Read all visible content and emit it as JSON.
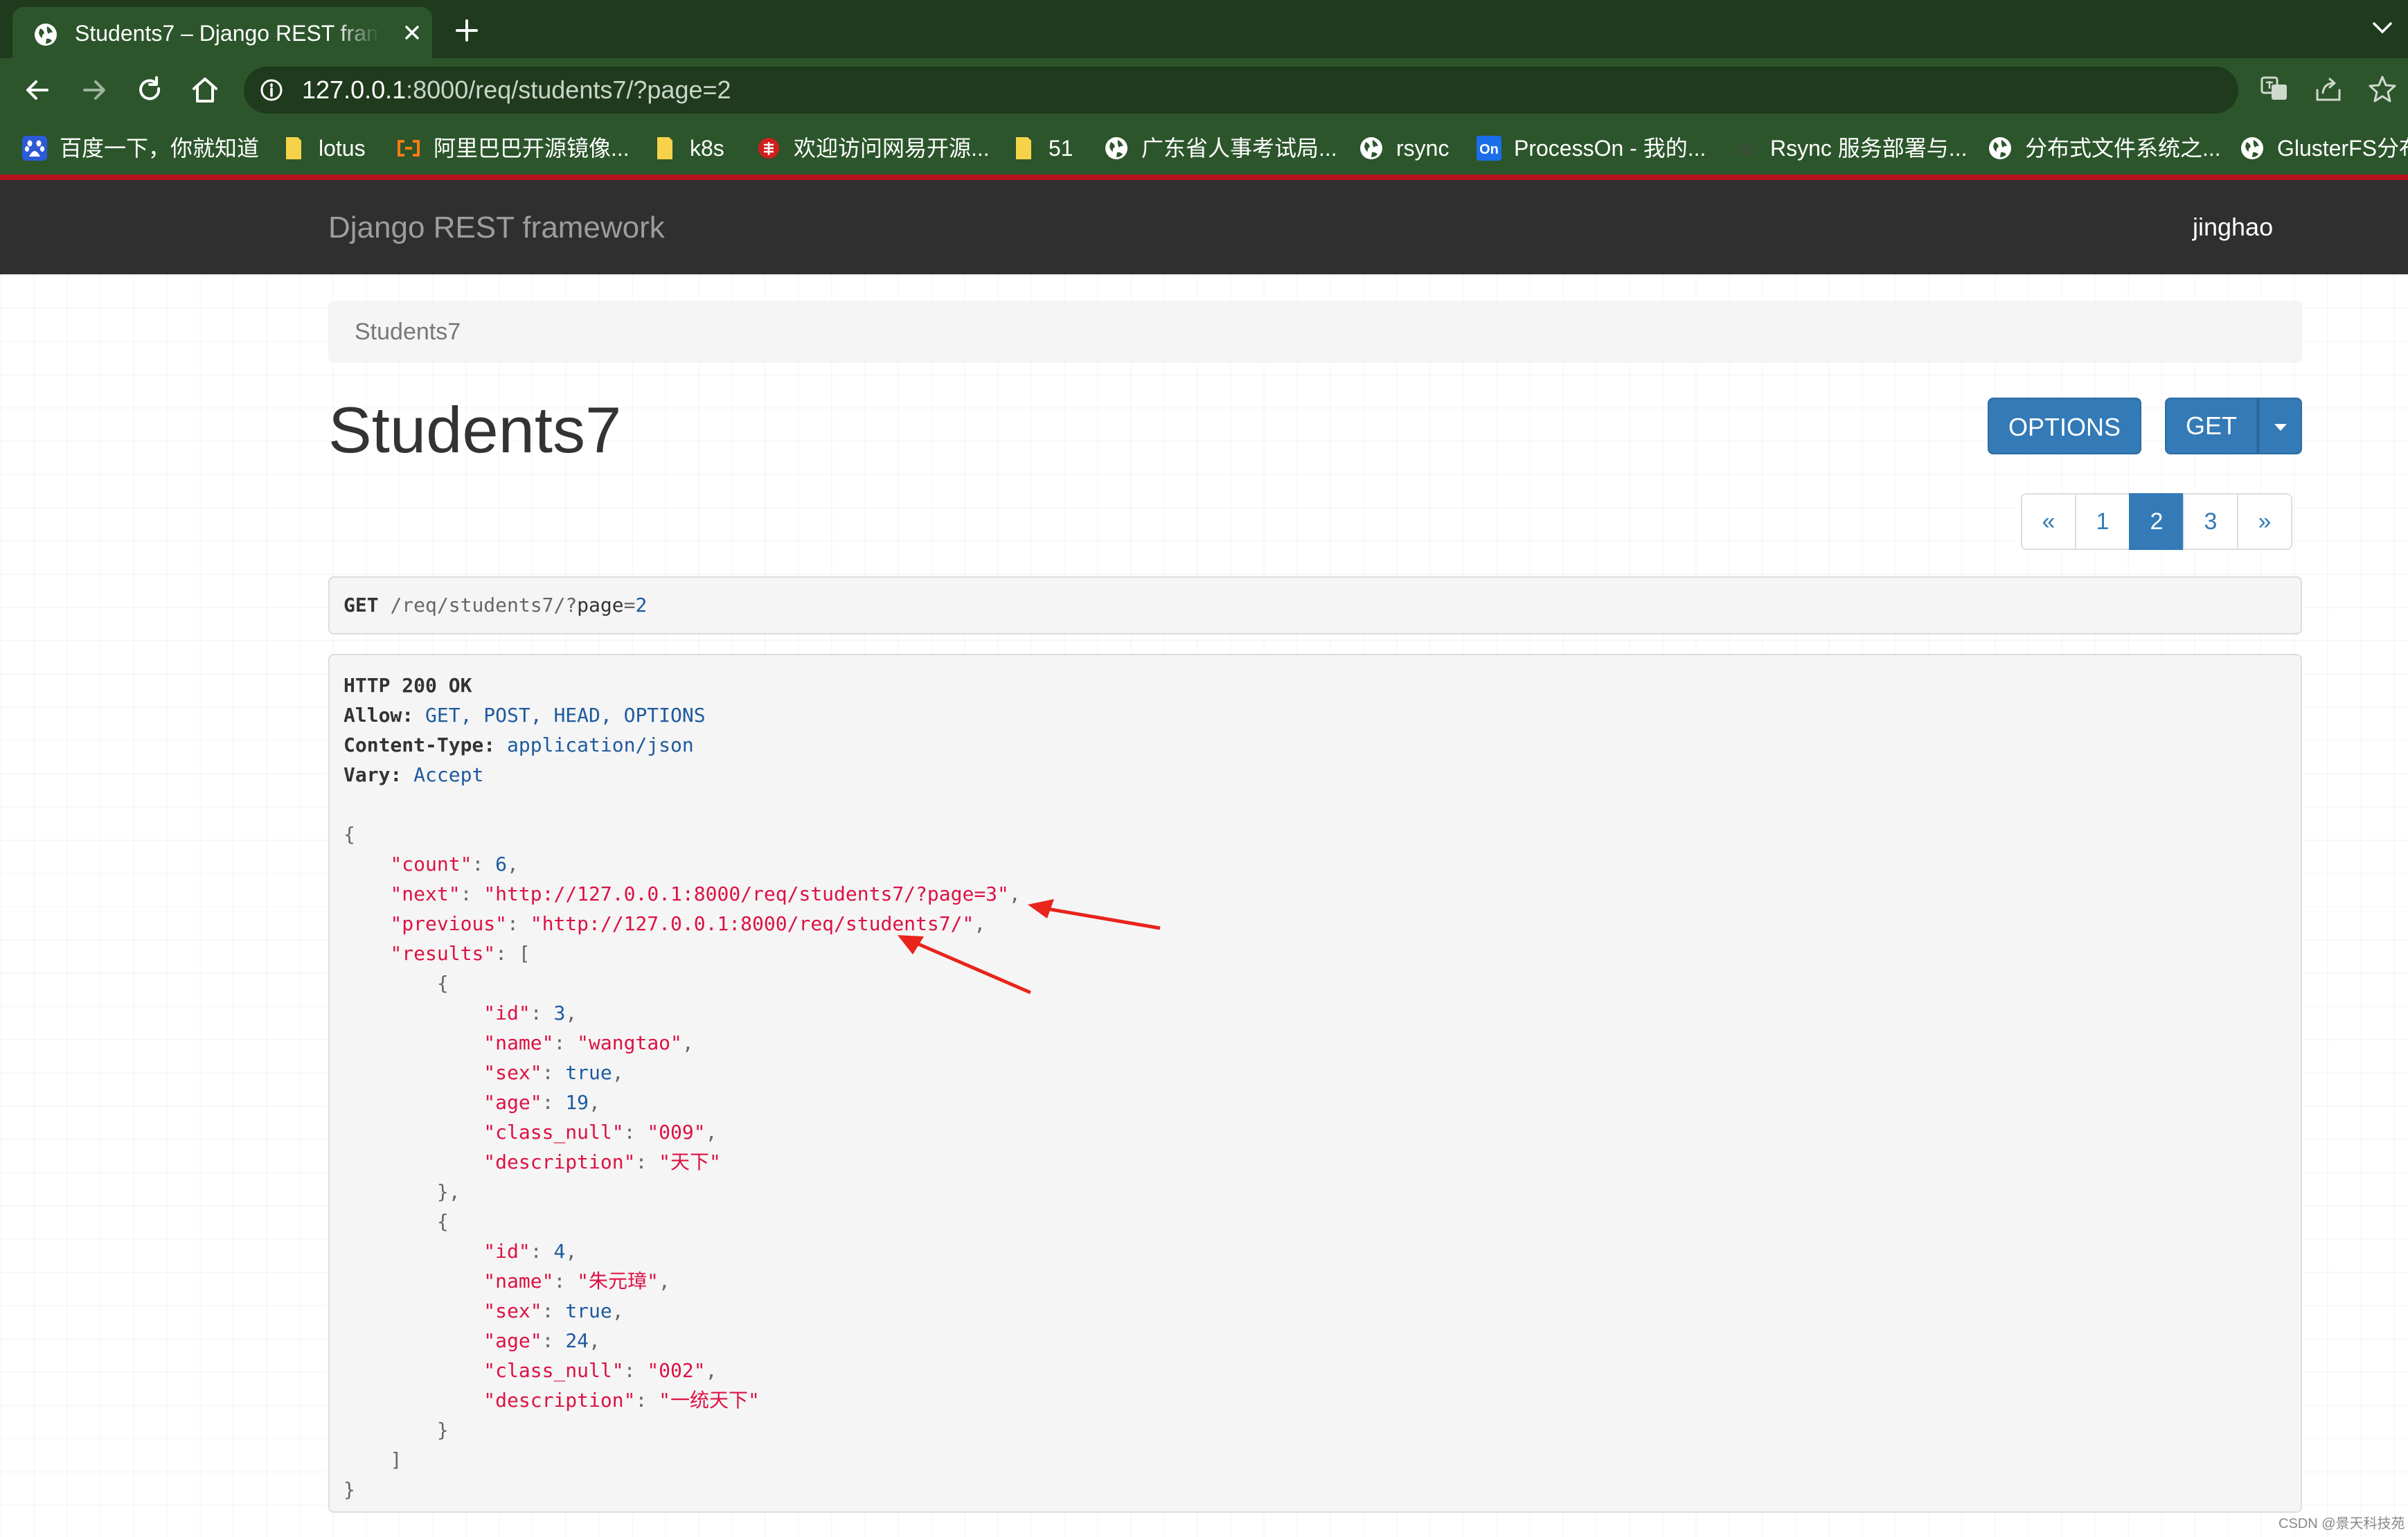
{
  "browser": {
    "tab": {
      "title": "Students7 – Django REST framework"
    },
    "address": {
      "host": "127.0.0.1",
      "rest": ":8000/req/students7/?page=2"
    },
    "bookmarks": [
      "百度一下，你就知道",
      "lotus",
      "阿里巴巴开源镜像...",
      "k8s",
      "欢迎访问网易开源...",
      "51",
      "广东省人事考试局...",
      "rsync",
      "ProcessOn - 我的...",
      "Rsync 服务部署与...",
      "分布式文件系统之...",
      "GlusterFS分布"
    ]
  },
  "drf": {
    "brand": "Django REST framework",
    "user": "jinghao",
    "breadcrumb": "Students7",
    "heading": "Students7",
    "buttons": {
      "options": "OPTIONS",
      "get": "GET"
    },
    "pagination": {
      "prev": "«",
      "pages": [
        "1",
        "2",
        "3"
      ],
      "active": "2",
      "next": "»"
    },
    "request": {
      "method": "GET",
      "path": "/req/students7/?page=2"
    },
    "response": {
      "status": "HTTP 200 OK",
      "headers": [
        {
          "name": "Allow:",
          "value": "GET, POST, HEAD, OPTIONS"
        },
        {
          "name": "Content-Type:",
          "value": "application/json"
        },
        {
          "name": "Vary:",
          "value": "Accept"
        }
      ],
      "body": {
        "count": 6,
        "next": "http://127.0.0.1:8000/req/students7/?page=3",
        "previous": "http://127.0.0.1:8000/req/students7/",
        "results": [
          {
            "id": 3,
            "name": "wangtao",
            "sex": true,
            "age": 19,
            "class_null": "009",
            "description": "天下"
          },
          {
            "id": 4,
            "name": "朱元璋",
            "sex": true,
            "age": 24,
            "class_null": "002",
            "description": "一统天下"
          }
        ]
      }
    }
  },
  "watermark": "CSDN @景天科技苑",
  "colors": {
    "accent": "#337ab7",
    "annotation": "#e8241c",
    "navbar": "#2f2f2f"
  }
}
